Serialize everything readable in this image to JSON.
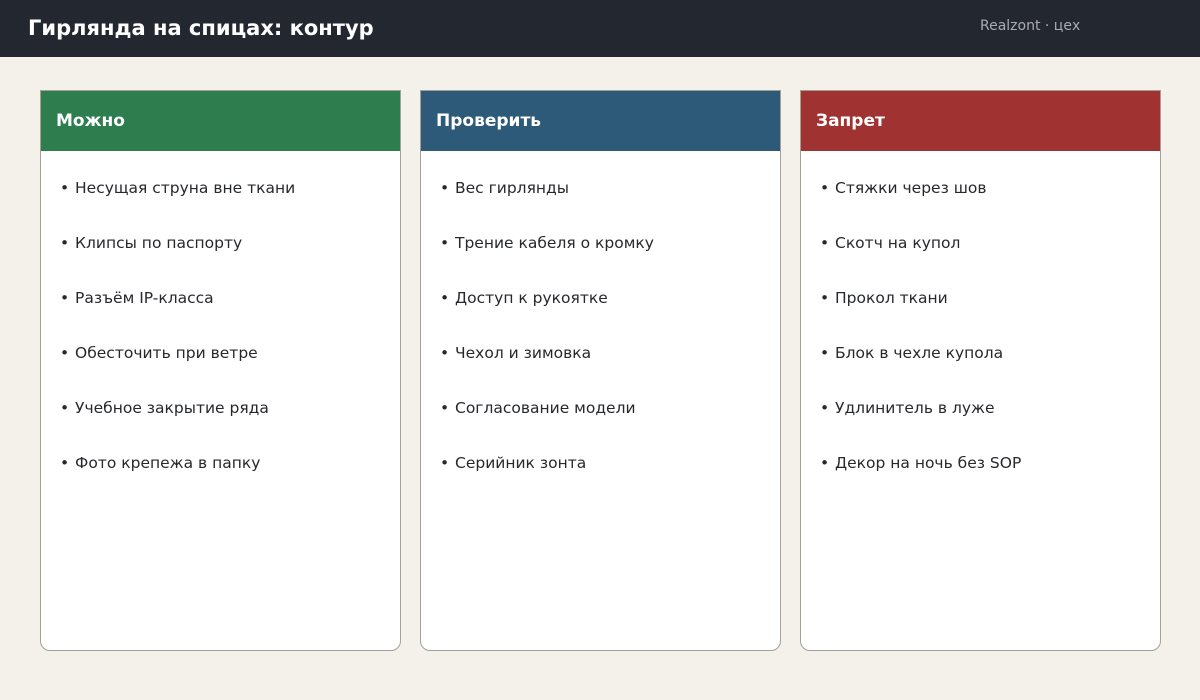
{
  "header": {
    "title": "Гирлянда на спицах: контур",
    "org": "Realzont · цех"
  },
  "colors": {
    "topbar": "#232730",
    "background": "#f4f1ea",
    "allowed": "#2e7d4f",
    "check": "#2d5a78",
    "forbidden": "#a13232"
  },
  "columns": [
    {
      "title": "Можно",
      "items": [
        "Несущая струна вне ткани",
        "Клипсы по паспорту",
        "Разъём IP-класса",
        "Обесточить при ветре",
        "Учебное закрытие ряда",
        "Фото крепежа в папку"
      ]
    },
    {
      "title": "Проверить",
      "items": [
        "Вес гирлянды",
        "Трение кабеля о кромку",
        "Доступ к рукоятке",
        "Чехол и зимовка",
        "Согласование модели",
        "Серийник зонта"
      ]
    },
    {
      "title": "Запрет",
      "items": [
        "Стяжки через шов",
        "Скотч на купол",
        "Прокол ткани",
        "Блок в чехле купола",
        "Удлинитель в луже",
        "Декор на ночь без SOP"
      ]
    }
  ]
}
